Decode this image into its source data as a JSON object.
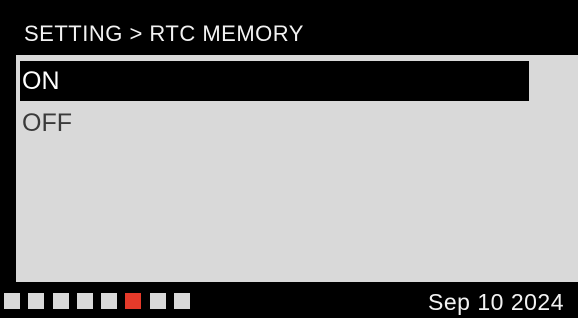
{
  "header": {
    "breadcrumb": "SETTING > RTC MEMORY"
  },
  "menu": {
    "items": [
      {
        "label": "ON",
        "selected": true
      },
      {
        "label": "OFF",
        "selected": false
      }
    ]
  },
  "footer": {
    "page_indicator": {
      "total": 8,
      "active_index": 5,
      "active_color": "#e53a2a",
      "inactive_color": "#d9d9d9"
    },
    "date": "Sep 10 2024"
  },
  "colors": {
    "background": "#000000",
    "panel": "#d9d9d9",
    "selected_bg": "#000000",
    "selected_text": "#ffffff",
    "item_text": "#3a3a3a"
  }
}
